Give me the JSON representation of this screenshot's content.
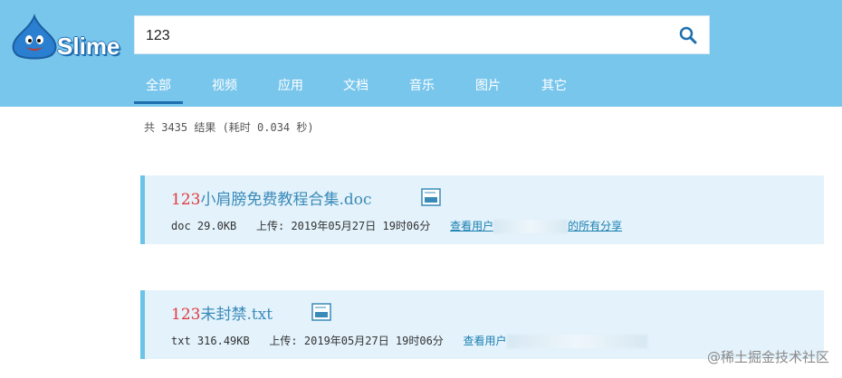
{
  "brand": {
    "name": "Slime"
  },
  "search": {
    "value": "123"
  },
  "tabs": [
    {
      "label": "全部",
      "active": true
    },
    {
      "label": "视频"
    },
    {
      "label": "应用"
    },
    {
      "label": "文档"
    },
    {
      "label": "音乐"
    },
    {
      "label": "图片"
    },
    {
      "label": "其它"
    }
  ],
  "result_summary": "共 3435 结果 (耗时 0.034 秒)",
  "results": [
    {
      "title_highlight": "123",
      "title_rest": "小肩膀免费教程合集.doc",
      "file_icon": "doc-file-icon",
      "type": "doc",
      "size": "29.0KB",
      "upload_label": "上传:",
      "date": "2019年05月27日 19时06分",
      "uploader_link_prefix": "查看用户",
      "uploader_link_suffix": "的所有分享"
    },
    {
      "title_highlight": "123",
      "title_rest": "未封禁.txt",
      "file_icon": "txt-file-icon",
      "type": "txt",
      "size": "316.49KB",
      "upload_label": "上传:",
      "date": "2019年05月27日 19时06分",
      "uploader_link_prefix": "查看用户",
      "uploader_link_suffix": ""
    }
  ],
  "watermark": "@稀土掘金技术社区",
  "colors": {
    "header_bg": "#79c6ec",
    "highlight": "#e4393c",
    "link": "#1a7fb0",
    "card_bg": "#e3f2fb"
  }
}
